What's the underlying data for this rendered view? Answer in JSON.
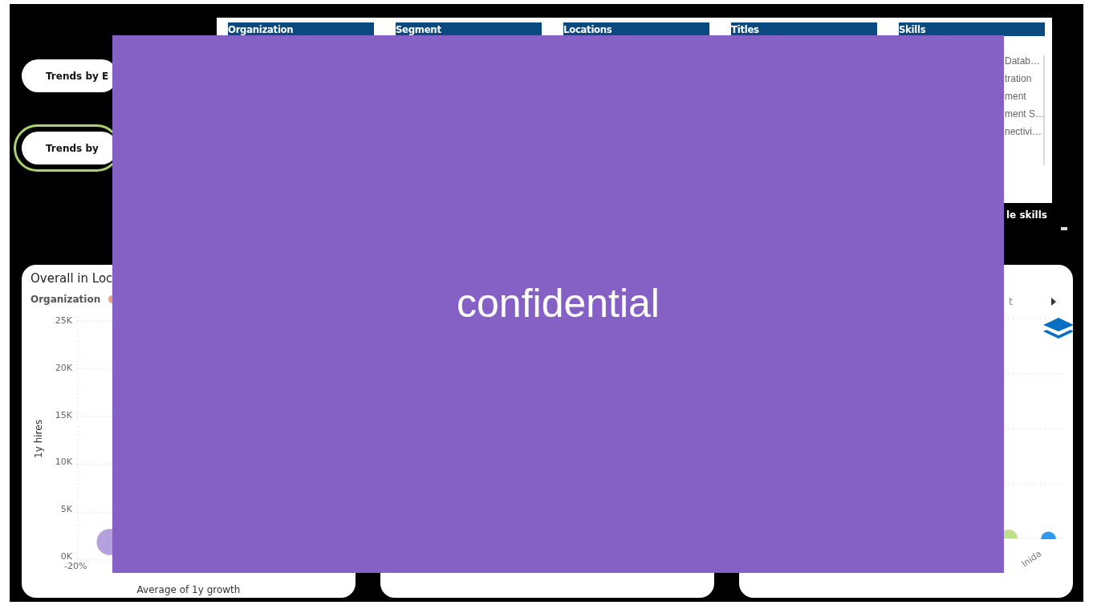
{
  "nav_buttons": [
    {
      "label": "Trends by E",
      "selected": false
    },
    {
      "label": "Trends by",
      "selected": true
    }
  ],
  "filter_headers": [
    "Organization",
    "Segment",
    "Locations",
    "Titles",
    "Skills"
  ],
  "skills_list": [
    "Datab…",
    "tration",
    "ment",
    "ment S…",
    "nectivi…"
  ],
  "skills_caption": "le skills",
  "cards": [
    {
      "kind": "scatter",
      "title": "Overall in Loc",
      "legend_title": "Organization",
      "y_axis_title": "1y hires",
      "y_ticks": [
        "25K",
        "20K",
        "15K",
        "10K",
        "5K",
        "0K"
      ],
      "x_ticks": [
        "-20%"
      ],
      "x_axis_title": "Average of 1y growth"
    },
    {
      "kind": "blank"
    },
    {
      "kind": "bubbles",
      "legend_text": "t",
      "x_labels": [
        "Inida"
      ]
    }
  ],
  "redaction_overlay": {
    "text": "confidential"
  }
}
